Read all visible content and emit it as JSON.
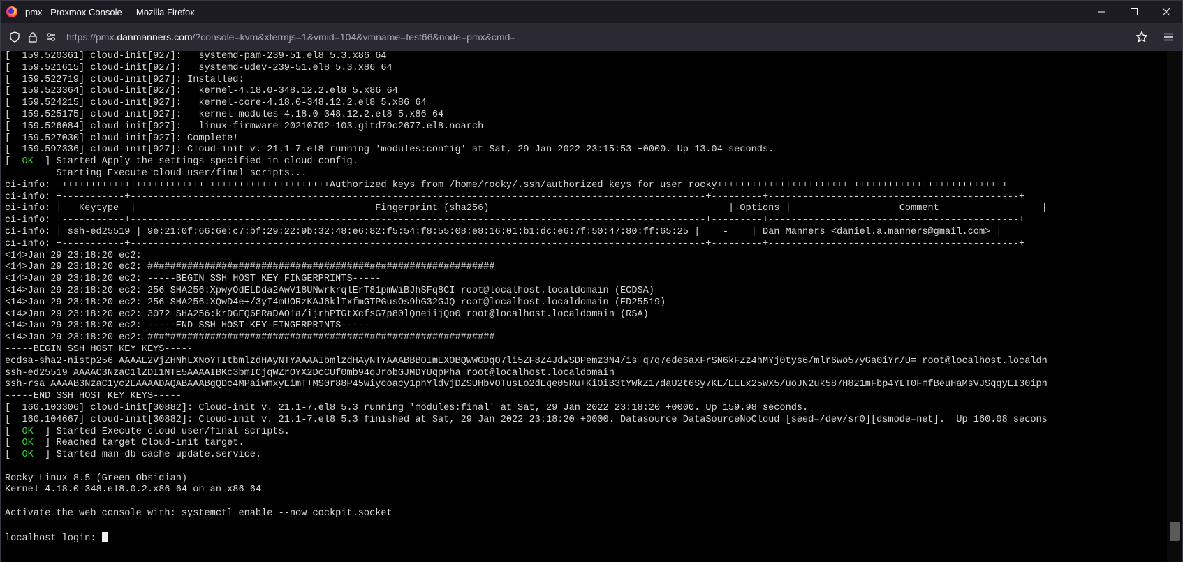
{
  "window": {
    "title": "pmx - Proxmox Console — Mozilla Firefox",
    "browser_icon": "firefox-icon"
  },
  "navbar": {
    "url_prefix": "https://pmx.",
    "url_domain": "danmanners.com",
    "url_rest": "/?console=kvm&xtermjs=1&vmid=104&vmname=test66&node=pmx&cmd="
  },
  "terminal": {
    "lines": [
      "[  159.520361] cloud-init[927]:   systemd-pam-239-51.el8 5.3.x86 64",
      "[  159.521615] cloud-init[927]:   systemd-udev-239-51.el8 5.3.x86 64",
      "[  159.522719] cloud-init[927]: Installed:",
      "[  159.523364] cloud-init[927]:   kernel-4.18.0-348.12.2.el8 5.x86 64",
      "[  159.524215] cloud-init[927]:   kernel-core-4.18.0-348.12.2.el8 5.x86 64",
      "[  159.525175] cloud-init[927]:   kernel-modules-4.18.0-348.12.2.el8 5.x86 64",
      "[  159.526084] cloud-init[927]:   linux-firmware-20210702-103.gitd79c2677.el8.noarch",
      "[  159.527030] cloud-init[927]: Complete!",
      "[  159.597336] cloud-init[927]: Cloud-init v. 21.1-7.el8 running 'modules:config' at Sat, 29 Jan 2022 23:15:53 +0000. Up 13.04 seconds.",
      "[  OK  ] Started Apply the settings specified in cloud-config.",
      "         Starting Execute cloud user/final scripts...",
      "ci-info: ++++++++++++++++++++++++++++++++++++++++++++++++Authorized keys from /home/rocky/.ssh/authorized keys for user rocky+++++++++++++++++++++++++++++++++++++++++++++++++++",
      "ci-info: +-----------+-----------------------------------------------------------------------------------------------------+---------+--------------------------------------------+",
      "ci-info: |   Keytype  |                                          Fingerprint (sha256)                                          | Options |                   Comment                  |",
      "ci-info: +-----------+-----------------------------------------------------------------------------------------------------+---------+--------------------------------------------+",
      "ci-info: | ssh-ed25519 | 9e:21:0f:66:6e:c7:bf:29:22:9b:32:48:e6:82:f5:54:f8:55:08:e8:16:01:b1:dc:e6:7f:50:47:80:ff:65:25 |    -    | Dan Manners <daniel.a.manners@gmail.com> |",
      "ci-info: +-----------+-----------------------------------------------------------------------------------------------------+---------+--------------------------------------------+",
      "<14>Jan 29 23:18:20 ec2:",
      "<14>Jan 29 23:18:20 ec2: #############################################################",
      "<14>Jan 29 23:18:20 ec2: -----BEGIN SSH HOST KEY FINGERPRINTS-----",
      "<14>Jan 29 23:18:20 ec2: 256 SHA256:XpwyOdELDda2AwV18UNwrkrqlErT81pmWiBJhSFq8CI root@localhost.localdomain (ECDSA)",
      "<14>Jan 29 23:18:20 ec2: 256 SHA256:XQwD4e+/3yI4mUORzKAJ6klIxfmGTPGusOs9hG32GJQ root@localhost.localdomain (ED25519)",
      "<14>Jan 29 23:18:20 ec2: 3072 SHA256:krDGEQ6PRaDAO1a/ijrhPTGtXcfsG7p80lQneiijQo0 root@localhost.localdomain (RSA)",
      "<14>Jan 29 23:18:20 ec2: -----END SSH HOST KEY FINGERPRINTS-----",
      "<14>Jan 29 23:18:20 ec2: #############################################################",
      "-----BEGIN SSH HOST KEY KEYS-----",
      "ecdsa-sha2-nistp256 AAAAE2VjZHNhLXNoYTItbmlzdHAyNTYAAAAIbmlzdHAyNTYAAABBBOImEXOBQWWGDqO7li5ZF8Z4JdWSDPemz3N4/is+q7q7ede6aXFrSN6kFZz4hMYj0tys6/mlr6wo57yGa0iYr/U= root@localhost.localdn",
      "ssh-ed25519 AAAAC3NzaC1lZDI1NTE5AAAAIBKc3bmICjqWZrOYX2DcCUf0mb94qJrobGJMDYUqpPha root@localhost.localdomain",
      "ssh-rsa AAAAB3NzaC1yc2EAAAADAQABAAABgQDc4MPaiwmxyEimT+MS0r88P45wiycoacy1pnYldvjDZSUHbVOTusLo2dEqe05Ru+KiOiB3tYWkZ17daU2t6Sy7KE/EELx25WX5/uoJN2uk587H821mFbp4YLT0FmfBeuHaMsVJSqqyEI30ipn",
      "-----END SSH HOST KEY KEYS-----",
      "[  160.103306] cloud-init[30882]: Cloud-init v. 21.1-7.el8 5.3 running 'modules:final' at Sat, 29 Jan 2022 23:18:20 +0000. Up 159.98 seconds.",
      "[  160.104667] cloud-init[30882]: Cloud-init v. 21.1-7.el8 5.3 finished at Sat, 29 Jan 2022 23:18:20 +0000. Datasource DataSourceNoCloud [seed=/dev/sr0][dsmode=net].  Up 160.08 secons",
      "[  OK  ] Started Execute cloud user/final scripts.",
      "[  OK  ] Reached target Cloud-init target.",
      "[  OK  ] Started man-db-cache-update.service.",
      "",
      "Rocky Linux 8.5 (Green Obsidian)",
      "Kernel 4.18.0-348.el8.0.2.x86 64 on an x86 64",
      "",
      "Activate the web console with: systemctl enable --now cockpit.socket",
      "",
      "localhost login: "
    ],
    "ok_label": "OK",
    "colors": {
      "background": "#000000",
      "foreground": "#d8d8d8",
      "ok": "#37c837"
    }
  }
}
